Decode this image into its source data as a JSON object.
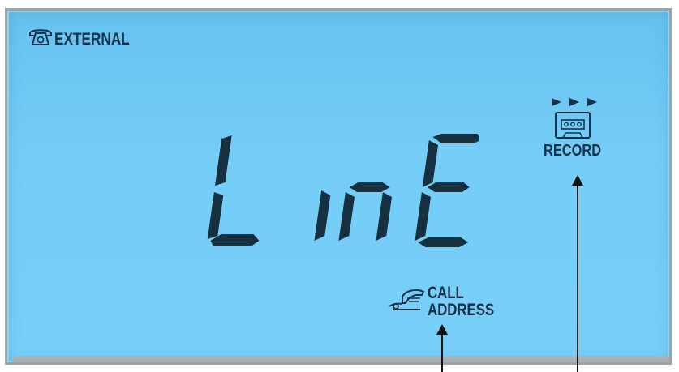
{
  "display": {
    "external_label": "EXTERNAL",
    "main_text": "L InE",
    "record_label": "RECORD",
    "call_label": "CALL",
    "address_label": "ADDRESS"
  },
  "icons": {
    "external": "telephone-icon",
    "record_arrows": "play-arrows-icon",
    "record": "cassette-icon",
    "call": "handset-icon",
    "pointers": "up-arrow-icon"
  },
  "colors": {
    "lcd_background": "#74cdf7",
    "segment_color": "#17303f",
    "label_color": "#15324a",
    "bezel": "#9aa3a8"
  }
}
